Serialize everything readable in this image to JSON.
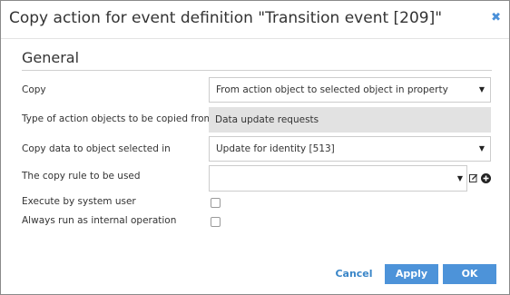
{
  "dialog": {
    "title": "Copy action for event definition \"Transition event [209]\"",
    "close_icon": "close-icon",
    "colors": {
      "accent": "#4d93d9",
      "link": "#3a86c8",
      "readonly_bg": "#e2e2e2"
    }
  },
  "section": {
    "title": "General"
  },
  "fields": {
    "copy": {
      "label": "Copy",
      "value": "From action object to selected object in property"
    },
    "type": {
      "label": "Type of action objects to be copied from",
      "value": "Data update requests"
    },
    "copy_to": {
      "label": "Copy data to object selected in",
      "value": "Update for identity [513]"
    },
    "rule": {
      "label": "The copy rule to be used",
      "value": ""
    },
    "system_user": {
      "label": "Execute by system user",
      "checked": false
    },
    "internal": {
      "label": "Always run as internal operation",
      "checked": false
    }
  },
  "buttons": {
    "cancel": "Cancel",
    "apply": "Apply",
    "ok": "OK"
  }
}
